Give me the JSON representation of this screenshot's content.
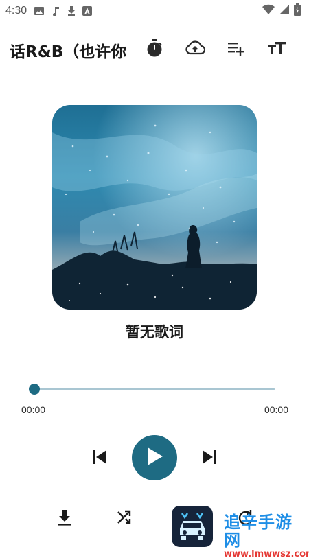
{
  "status_bar": {
    "time": "4:30"
  },
  "toolbar": {
    "title": "话R&B（也许你",
    "icons": [
      "timer-icon",
      "cloud-upload-icon",
      "playlist-add-icon",
      "text-size-icon"
    ]
  },
  "player": {
    "lyrics": "暂无歌词",
    "current_time": "00:00",
    "total_time": "00:00",
    "progress": 0
  },
  "watermark": {
    "cn": "追辛手游网",
    "url": "www.lmwwsz.com"
  },
  "colors": {
    "accent": "#1e6b83",
    "track": "#a9c6d2",
    "watermark_blue": "#1f8ee6",
    "watermark_red": "#e53935"
  }
}
